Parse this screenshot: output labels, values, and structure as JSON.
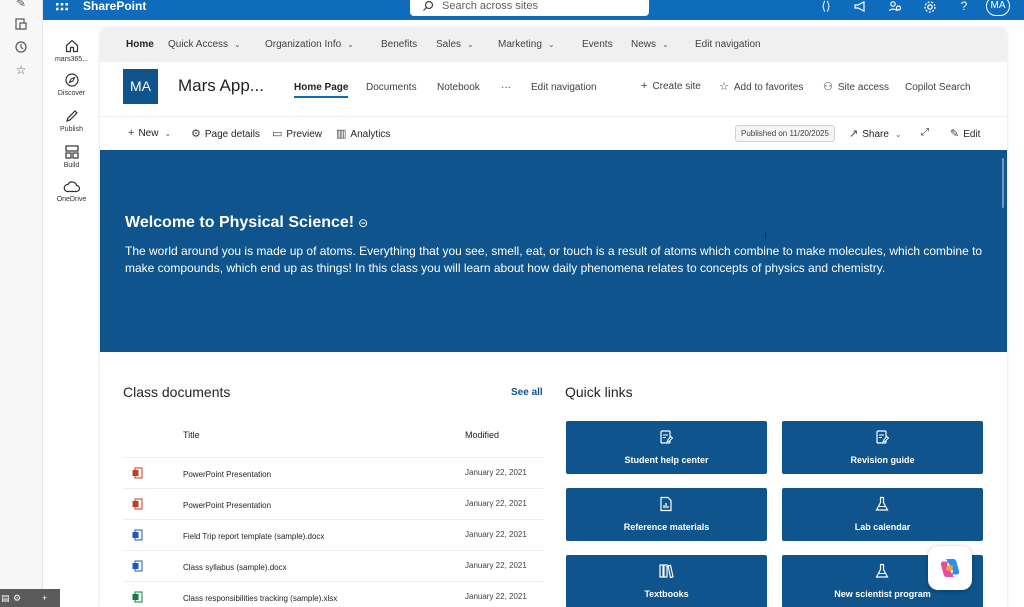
{
  "suite_bar": {
    "brand": "SharePoint",
    "search_placeholder": "Search across sites",
    "avatar_initials": "MA",
    "help_glyph": "?"
  },
  "app_bar": {
    "items": [
      {
        "label": "mars365...",
        "icon": "home-icon"
      },
      {
        "label": "Discover",
        "icon": "discover-icon"
      },
      {
        "label": "Publish",
        "icon": "pencil-icon"
      },
      {
        "label": "Build",
        "icon": "build-icon"
      },
      {
        "label": "OneDrive",
        "icon": "cloud-icon"
      }
    ]
  },
  "hub_nav": {
    "items": [
      {
        "label": "Home",
        "active": true
      },
      {
        "label": "Quick Access",
        "dropdown": true
      },
      {
        "label": "Organization Info",
        "dropdown": true
      },
      {
        "label": "Benefits"
      },
      {
        "label": "Sales",
        "dropdown": true
      },
      {
        "label": "Marketing",
        "dropdown": true
      },
      {
        "label": "Events"
      },
      {
        "label": "News",
        "dropdown": true
      },
      {
        "label": "Edit navigation"
      }
    ]
  },
  "site_header": {
    "logo_initials": "MA",
    "title": "Mars App...",
    "nav": [
      {
        "label": "Home Page",
        "active": true
      },
      {
        "label": "Documents"
      },
      {
        "label": "Notebook"
      },
      {
        "label": "···"
      },
      {
        "label": "Edit navigation"
      }
    ],
    "actions": [
      {
        "label": "Create site",
        "icon": "plus-icon"
      },
      {
        "label": "Add to favorites",
        "icon": "star-icon"
      },
      {
        "label": "Site access",
        "icon": "people-icon"
      },
      {
        "label": "Copilot Search",
        "icon": ""
      }
    ]
  },
  "command_bar": {
    "new": "New",
    "page_details": "Page details",
    "preview": "Preview",
    "analytics": "Analytics",
    "published": "Published on 11/20/2025",
    "share": "Share",
    "edit": "Edit"
  },
  "hero": {
    "title": "Welcome to Physical Science!",
    "body": "The world around you is made up of atoms. Everything that you see, smell, eat, or touch is a result of atoms which combine to make molecules, which combine to make compounds, which end up as things! In this class you will learn about how daily phenomena relates to concepts of physics and chemistry."
  },
  "class_documents": {
    "title": "Class documents",
    "see_all": "See all",
    "columns": {
      "title": "Title",
      "modified": "Modified"
    },
    "rows": [
      {
        "name": "PowerPoint Presentation",
        "modified": "January 22, 2021",
        "type": "pptx"
      },
      {
        "name": "PowerPoint Presentation",
        "modified": "January 22, 2021",
        "type": "pptx"
      },
      {
        "name": "Field Trip report template (sample).docx",
        "modified": "January 22, 2021",
        "type": "docx"
      },
      {
        "name": "Class syllabus (sample).docx",
        "modified": "January 22, 2021",
        "type": "docx"
      },
      {
        "name": "Class responsibilities tracking (sample).xlsx",
        "modified": "January 22, 2021",
        "type": "xlsx"
      }
    ]
  },
  "quick_links": {
    "title": "Quick links",
    "tiles": [
      {
        "label": "Student help center",
        "icon": "notepad-edit-icon"
      },
      {
        "label": "Revision guide",
        "icon": "notepad-edit-icon"
      },
      {
        "label": "Reference materials",
        "icon": "report-icon"
      },
      {
        "label": "Lab calendar",
        "icon": "flask-icon"
      },
      {
        "label": "Textbooks",
        "icon": "books-icon"
      },
      {
        "label": "New scientist program",
        "icon": "flask-icon"
      }
    ]
  },
  "colors": {
    "suite_blue": "#0f6cbd",
    "brand_dark_blue": "#0f548c",
    "pptx": "#c43e1c",
    "docx": "#185abd",
    "xlsx": "#107c41"
  }
}
